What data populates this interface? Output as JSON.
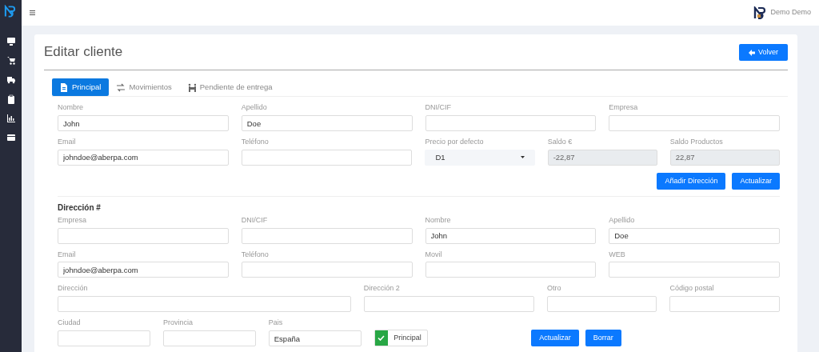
{
  "topbar": {
    "user": "Demo Demo"
  },
  "page": {
    "title": "Editar cliente",
    "back_button": "Volver"
  },
  "tabs": [
    {
      "label": "Principal",
      "selected": true
    },
    {
      "label": "Movimientos",
      "selected": false
    },
    {
      "label": "Pendiente de entrega",
      "selected": false
    }
  ],
  "client_form": {
    "rows": [
      [
        {
          "label": "Nombre",
          "kind": "text",
          "value": "John"
        },
        {
          "label": "Apellido",
          "kind": "text",
          "value": "Doe"
        },
        {
          "label": "DNI/CIF",
          "kind": "text"
        },
        {
          "label": "Empresa",
          "kind": "text"
        }
      ],
      [
        {
          "label": "Email",
          "kind": "text",
          "value": "johndoe@aberpa.com"
        },
        {
          "label": "Teléfono",
          "kind": "text"
        },
        {
          "label": "Precio por defecto",
          "kind": "select",
          "value": "D1"
        },
        {
          "label": "Saldo €",
          "kind": "readonly",
          "value": "-22,87"
        },
        {
          "label": "Saldo Productos",
          "kind": "readonly",
          "value": "22,87"
        }
      ]
    ],
    "buttons": [
      "Añadir Dirección",
      "Actualizar"
    ]
  },
  "address": {
    "heading": "Dirección #",
    "rows": [
      [
        {
          "label": "Empresa",
          "kind": "text"
        },
        {
          "label": "DNI/CIF",
          "kind": "text"
        },
        {
          "label": "Nombre",
          "kind": "text",
          "value": "John"
        },
        {
          "label": "Apellido",
          "kind": "text",
          "value": "Doe"
        }
      ],
      [
        {
          "label": "Email",
          "kind": "text",
          "value": "johndoe@aberpa.com"
        },
        {
          "label": "Teléfono",
          "kind": "text"
        },
        {
          "label": "Movil",
          "kind": "text"
        },
        {
          "label": "WEB",
          "kind": "text"
        }
      ],
      [
        {
          "label": "Dirección",
          "kind": "text"
        },
        {
          "label": "Dirección 2",
          "kind": "text"
        },
        {
          "label": "Otro",
          "kind": "text"
        },
        {
          "label": "Código postal",
          "kind": "text"
        }
      ],
      [
        {
          "label": "Ciudad",
          "kind": "text"
        },
        {
          "label": "Provincia",
          "kind": "text"
        },
        {
          "label": "Pais",
          "kind": "text",
          "value": "España"
        }
      ]
    ],
    "principal": {
      "label": "Principal",
      "checked": true
    },
    "buttons": [
      "Actualizar",
      "Borrar"
    ]
  }
}
